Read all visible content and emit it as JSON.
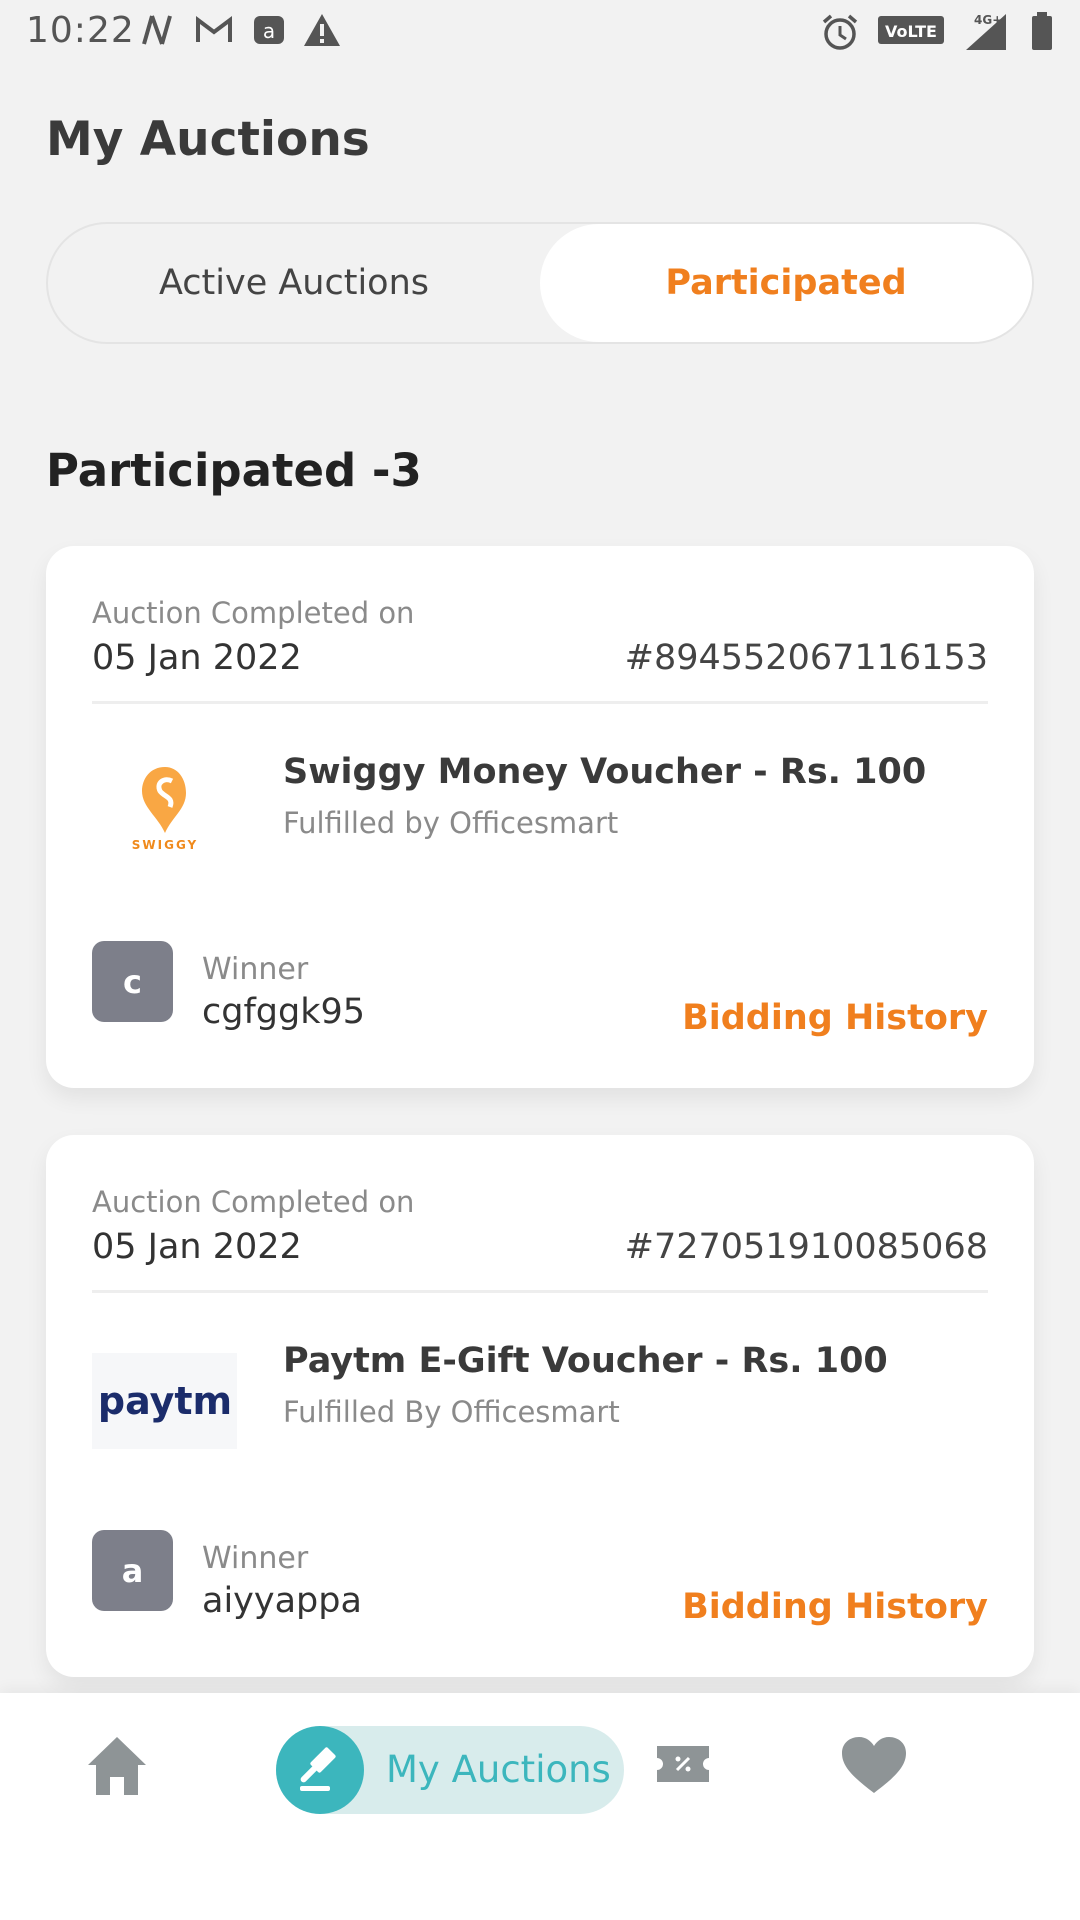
{
  "status_bar": {
    "time": "10:22",
    "volte": "VoLTE",
    "network": "4G+"
  },
  "page": {
    "title": "My Auctions"
  },
  "tabs": [
    {
      "label": "Active Auctions",
      "active": false
    },
    {
      "label": "Participated",
      "active": true
    }
  ],
  "section": {
    "title": "Participated -3"
  },
  "cards": [
    {
      "completed_label": "Auction Completed on",
      "date": "05 Jan 2022",
      "auction_id": "#894552067116153",
      "product_name": "Swiggy Money Voucher - Rs. 100",
      "fulfilled_by": "Fulfilled by Officesmart",
      "logo": {
        "icon": "swiggy-logo",
        "text": "SWIGGY"
      },
      "winner_label": "Winner",
      "winner_initial": "c",
      "winner_name": "cgfggk95",
      "history_label": "Bidding History"
    },
    {
      "completed_label": "Auction Completed on",
      "date": "05 Jan 2022",
      "auction_id": "#727051910085068",
      "product_name": "Paytm E-Gift Voucher - Rs. 100",
      "fulfilled_by": "Fulfilled By Officesmart",
      "logo": {
        "icon": "paytm-logo",
        "text": "paytm"
      },
      "winner_label": "Winner",
      "winner_initial": "a",
      "winner_name": "aiyyappa",
      "history_label": "Bidding History"
    }
  ],
  "bottom_nav": {
    "items": [
      {
        "icon": "home-icon",
        "active": false
      },
      {
        "icon": "gavel-icon",
        "label": "My Auctions",
        "active": true
      },
      {
        "icon": "ticket-icon",
        "active": false
      },
      {
        "icon": "heart-icon",
        "active": false
      }
    ]
  },
  "colors": {
    "accent": "#f07f1e",
    "teal": "#3cb6bd",
    "avatar": "#7d7f8a",
    "background": "#f2f2f2"
  }
}
